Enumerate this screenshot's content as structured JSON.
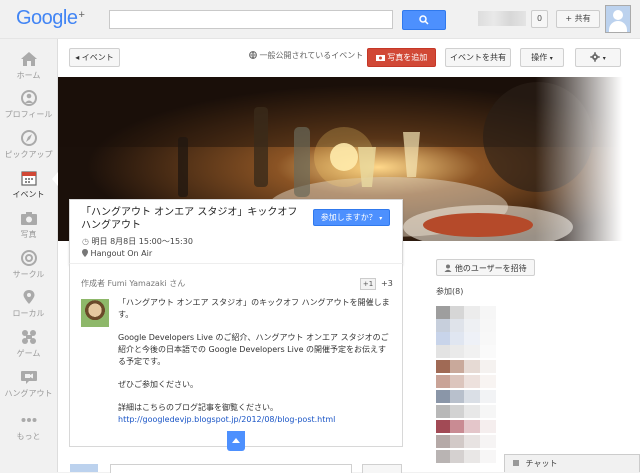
{
  "header": {
    "logo": "Google",
    "logo_suffix": "+",
    "notifications": "0",
    "share_label": "+ 共有"
  },
  "nav": {
    "items": [
      {
        "label": "ホーム",
        "icon": "home-icon"
      },
      {
        "label": "プロフィール",
        "icon": "profile-icon"
      },
      {
        "label": "ピックアップ",
        "icon": "compass-icon"
      },
      {
        "label": "イベント",
        "icon": "calendar-icon"
      },
      {
        "label": "写真",
        "icon": "camera-icon"
      },
      {
        "label": "サークル",
        "icon": "circles-icon"
      },
      {
        "label": "ローカル",
        "icon": "pin-icon"
      },
      {
        "label": "ゲーム",
        "icon": "games-icon"
      },
      {
        "label": "ハングアウト",
        "icon": "hangout-icon"
      },
      {
        "label": "もっと",
        "icon": "more-icon"
      }
    ],
    "active": "イベント"
  },
  "actionbar": {
    "back": "◂ イベント",
    "visibility": "一般公開されているイベント",
    "add_photo": "写真を追加",
    "share_event": "イベントを共有",
    "operations": "操作",
    "settings_icon": "gear-icon"
  },
  "event": {
    "title": "「ハングアウト オンエア スタジオ」キックオフハングアウト",
    "join": "参加しますか？",
    "date": "明日 8月8日 15:00～15:30",
    "location": "Hangout On Air"
  },
  "post": {
    "author": "作成者 Fumi Yamazaki さん",
    "plus1": "+1",
    "plus_count": "+3",
    "paragraphs": [
      "「ハングアウト オンエア スタジオ」のキックオフ ハングアウトを開催します。",
      "Google Developers Live のご紹介、ハングアウト オンエア スタジオのご紹介と今後の日本語での Google Developers Live の開催予定をお伝えする予定です。",
      "ぜひご参加ください。",
      "詳細はこちらのブログ記事を御覧ください。"
    ],
    "link": "http://googledevjp.blogspot.jp/2012/08/blog-post.html"
  },
  "sidebar": {
    "invite": "他のユーザーを招待",
    "participants": "参加(8)"
  },
  "chat": {
    "label": "チャット"
  },
  "colors": {
    "accent_blue": "#4d90fe",
    "accent_red": "#d14836"
  }
}
